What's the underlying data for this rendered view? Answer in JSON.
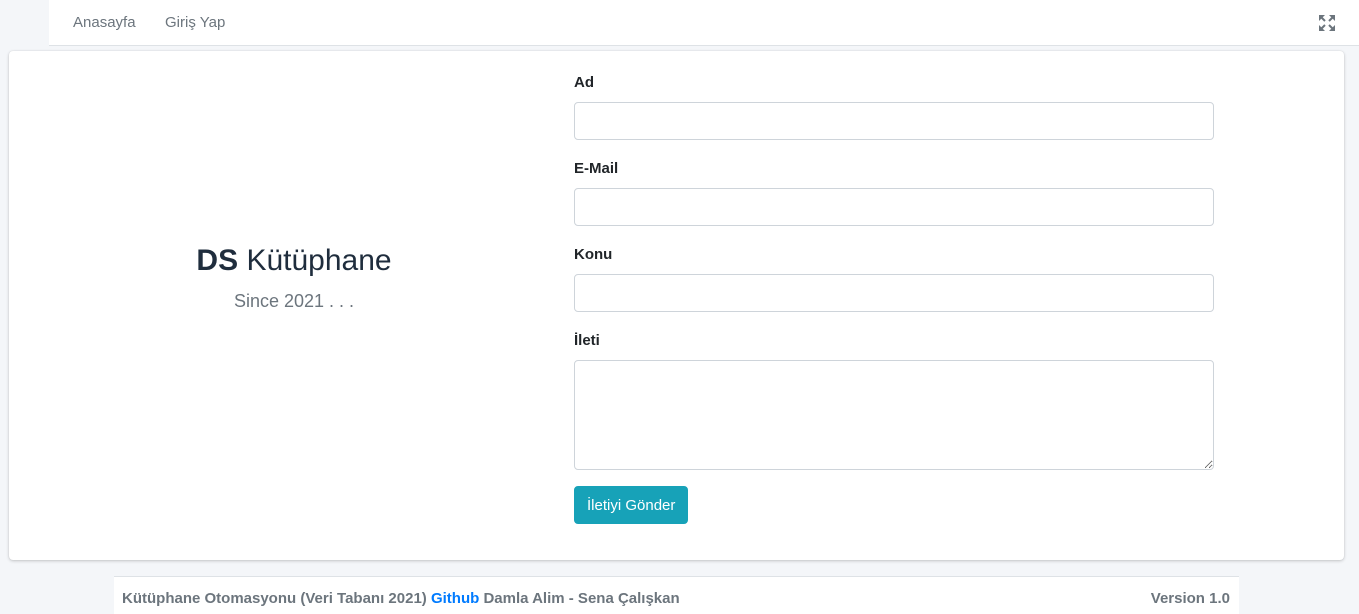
{
  "nav": {
    "home_label": "Anasayfa",
    "login_label": "Giriş Yap",
    "fullscreen_icon": "expand-arrows-icon"
  },
  "brand": {
    "bold": "DS",
    "name": "Kütüphane",
    "tagline": "Since 2021 . . ."
  },
  "form": {
    "name_label": "Ad",
    "name_value": "",
    "email_label": "E-Mail",
    "email_value": "",
    "subject_label": "Konu",
    "subject_value": "",
    "message_label": "İleti",
    "message_value": "",
    "submit_label": "İletiyi Gönder"
  },
  "footer": {
    "text": "Kütüphane Otomasyonu (Veri Tabanı 2021)",
    "link_label": "Github",
    "authors": "Damla Alim - Sena Çalışkan",
    "version": "Version 1.0"
  },
  "colors": {
    "accent": "#17a2b8",
    "link": "#007bff",
    "background": "#f4f6f9"
  }
}
